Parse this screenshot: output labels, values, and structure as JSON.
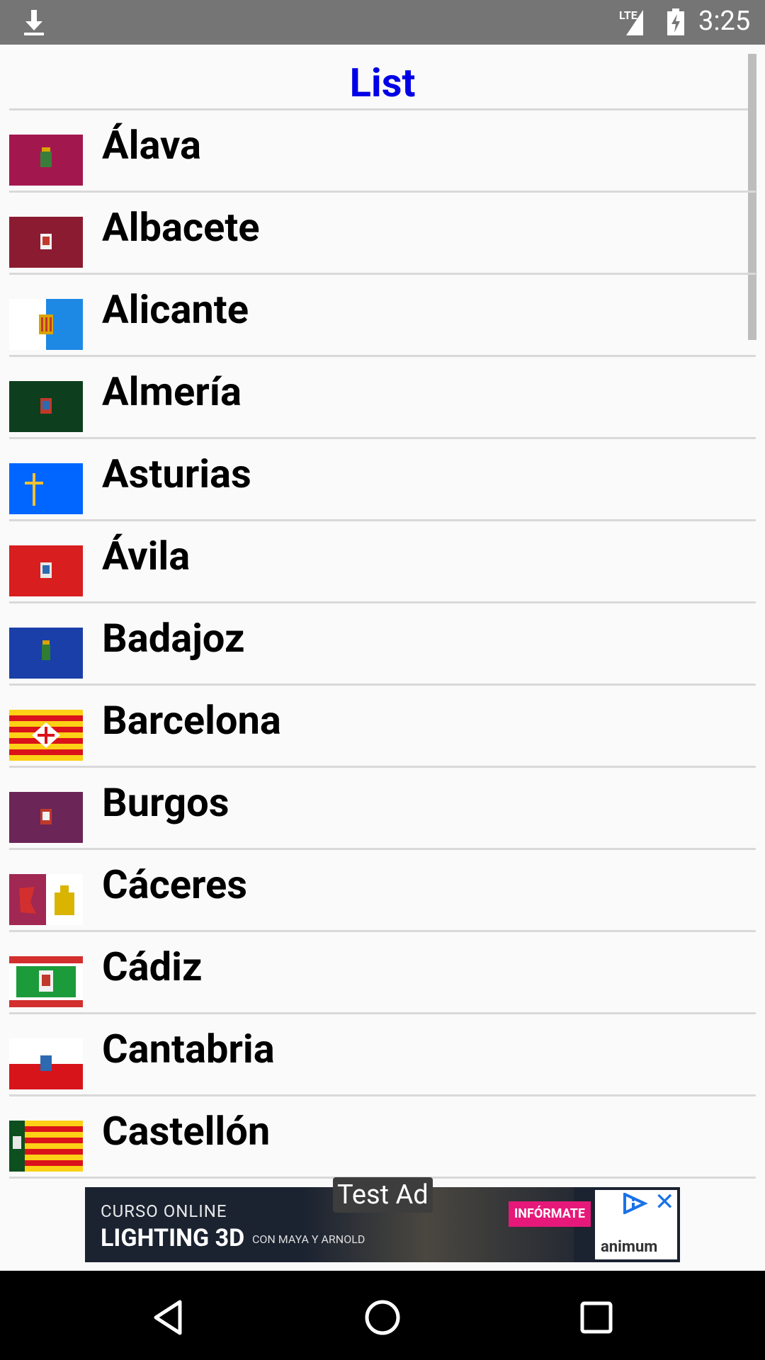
{
  "status_bar": {
    "time": "3:25",
    "network": "LTE",
    "icons": [
      "download-icon",
      "signal-icon",
      "battery-charging-icon"
    ]
  },
  "title": "List",
  "provinces": [
    {
      "name": "Álava",
      "flag": "alava"
    },
    {
      "name": "Albacete",
      "flag": "albacete"
    },
    {
      "name": "Alicante",
      "flag": "alicante"
    },
    {
      "name": "Almería",
      "flag": "almeria"
    },
    {
      "name": "Asturias",
      "flag": "asturias"
    },
    {
      "name": "Ávila",
      "flag": "avila"
    },
    {
      "name": "Badajoz",
      "flag": "badajoz"
    },
    {
      "name": "Barcelona",
      "flag": "barcelona"
    },
    {
      "name": "Burgos",
      "flag": "burgos"
    },
    {
      "name": "Cáceres",
      "flag": "caceres"
    },
    {
      "name": "Cádiz",
      "flag": "cadiz"
    },
    {
      "name": "Cantabria",
      "flag": "cantabria"
    },
    {
      "name": "Castellón",
      "flag": "castellon"
    }
  ],
  "ad": {
    "label": "Test Ad",
    "line1": "CURSO ONLINE",
    "line2": "LIGHTING 3D",
    "line3": "CON MAYA Y ARNOLD",
    "cta": "INFÓRMATE",
    "brand": "animum"
  },
  "nav_bar": {
    "buttons": [
      "back-icon",
      "home-icon",
      "recents-icon"
    ]
  },
  "colors": {
    "title": "#0000e6",
    "status_bar": "#757575",
    "ad_cta": "#e6197a"
  }
}
